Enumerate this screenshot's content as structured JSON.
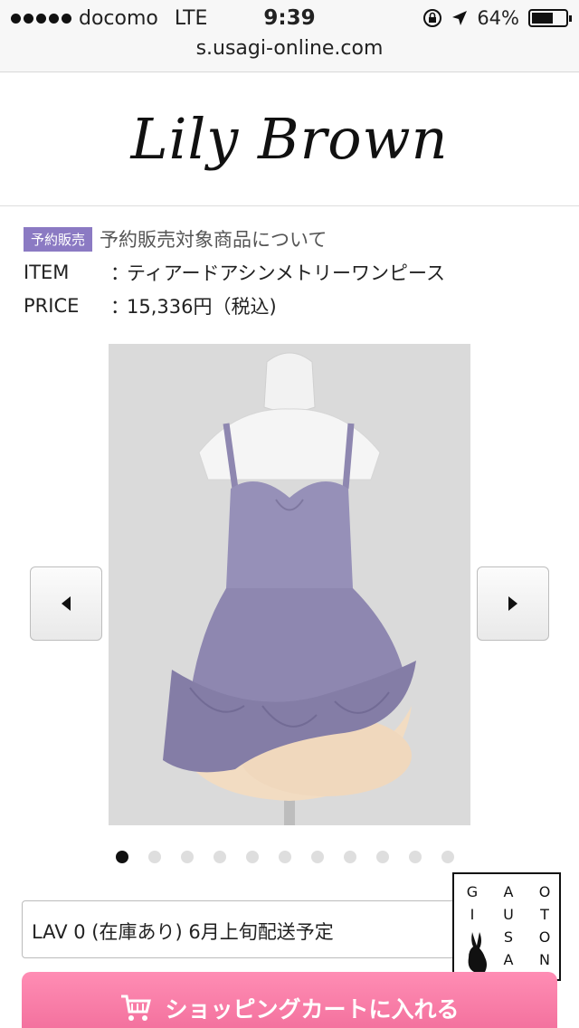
{
  "status_bar": {
    "carrier": "docomo",
    "network": "LTE",
    "time": "9:39",
    "battery": "64%",
    "battery_level": 0.64
  },
  "browser": {
    "url": "s.usagi-online.com"
  },
  "header": {
    "logo_text": "Lily Brown"
  },
  "product": {
    "badge": "予約販売",
    "reserve_link": "予約販売対象商品について",
    "item_label": "ITEM",
    "item_sep": "：",
    "item_name": "ティアードアシンメトリーワンピース",
    "price_label": "PRICE",
    "price_sep": "：",
    "price": "15,336円（税込)"
  },
  "gallery": {
    "image_name": "lavender-tiered-dress-photo",
    "slide_count": 11,
    "active_slide": 1
  },
  "variant": {
    "selected": "LAV 0 (在庫あり) 6月上旬配送予定"
  },
  "gaiusa_badge": {
    "col1": [
      "G",
      "I"
    ],
    "col2": [
      "A",
      "U",
      "S",
      "A"
    ],
    "col3": [
      "O",
      "T",
      "O",
      "N"
    ]
  },
  "cart": {
    "label": "ショッピングカートに入れる",
    "icon": "cart-icon"
  },
  "colors": {
    "badge_purple": "#8b7ac3",
    "cart_pink": "#f06a98",
    "dress_lavender": "#8e87b0",
    "tulle_cream": "#f2dcc2"
  }
}
